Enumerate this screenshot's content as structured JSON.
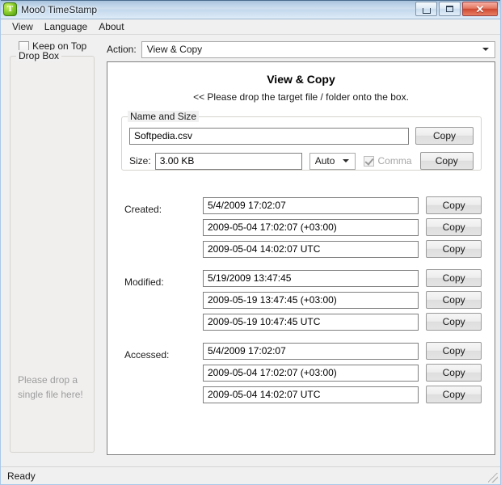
{
  "window": {
    "title": "Moo0 TimeStamp",
    "icon": "app-logo-icon",
    "buttons": {
      "minimize": "minimize-icon",
      "maximize": "maximize-icon",
      "close": "✕"
    }
  },
  "menubar": {
    "items": [
      {
        "label": "View"
      },
      {
        "label": "Language"
      },
      {
        "label": "About"
      }
    ]
  },
  "sidebar": {
    "keep_on_top": {
      "label": "Keep on Top",
      "checked": false
    },
    "drop_box": {
      "title": "Drop Box",
      "placeholder": "Please drop a single file here!"
    }
  },
  "action": {
    "label": "Action:",
    "selected": "View & Copy",
    "options": [
      "View & Copy"
    ]
  },
  "panel": {
    "title": "View & Copy",
    "subtitle": "<< Please drop the target file / folder onto the box.",
    "name_and_size": {
      "title": "Name and Size",
      "file_name": "Softpedia.csv",
      "copy_name_label": "Copy",
      "size_label": "Size:",
      "size_value": "3.00 KB",
      "unit_selected": "Auto",
      "unit_options": [
        "Auto"
      ],
      "comma_label": "Comma",
      "comma_checked": true,
      "comma_disabled": true,
      "copy_size_label": "Copy"
    },
    "timestamps": [
      {
        "label": "Created:",
        "rows": [
          {
            "value": "5/4/2009 17:02:07",
            "copy_label": "Copy"
          },
          {
            "value": "2009-05-04 17:02:07 (+03:00)",
            "copy_label": "Copy"
          },
          {
            "value": "2009-05-04 14:02:07 UTC",
            "copy_label": "Copy"
          }
        ]
      },
      {
        "label": "Modified:",
        "rows": [
          {
            "value": "5/19/2009 13:47:45",
            "copy_label": "Copy"
          },
          {
            "value": "2009-05-19 13:47:45 (+03:00)",
            "copy_label": "Copy"
          },
          {
            "value": "2009-05-19 10:47:45 UTC",
            "copy_label": "Copy"
          }
        ]
      },
      {
        "label": "Accessed:",
        "rows": [
          {
            "value": "5/4/2009 17:02:07",
            "copy_label": "Copy"
          },
          {
            "value": "2009-05-04 17:02:07 (+03:00)",
            "copy_label": "Copy"
          },
          {
            "value": "2009-05-04 14:02:07 UTC",
            "copy_label": "Copy"
          }
        ]
      }
    ]
  },
  "statusbar": {
    "text": "Ready"
  },
  "colors": {
    "title_bar_top": "#a8c3dd",
    "title_bar_bottom": "#e4eef8",
    "close_button": "#cf4a32",
    "panel_background": "#ffffff",
    "window_background": "#f0f0f0",
    "placeholder_text": "#9d9d9d"
  }
}
